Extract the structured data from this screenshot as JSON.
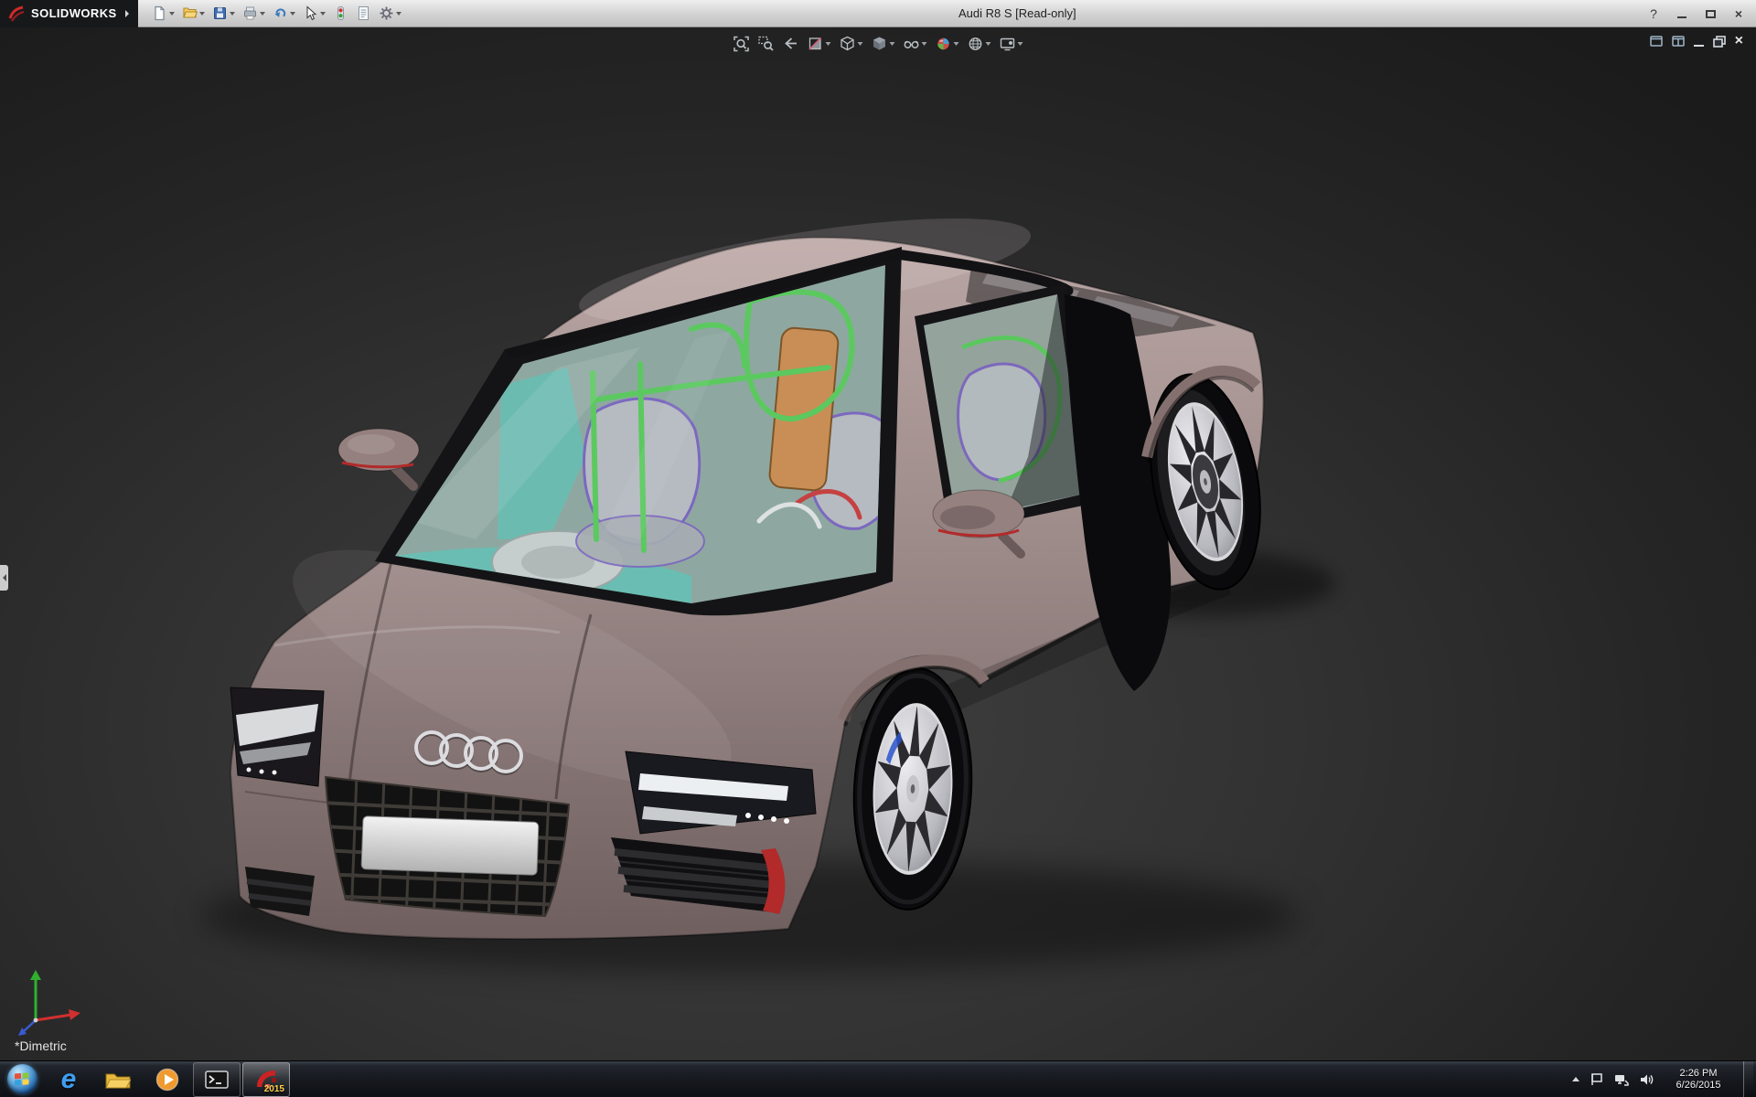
{
  "titlebar": {
    "logo_text": "SOLIDWORKS",
    "title": "Audi R8 S [Read-only]",
    "help_glyph": "?",
    "toolbar_icons": [
      "new-document-icon",
      "open-icon",
      "save-icon",
      "print-icon",
      "undo-icon",
      "select-cursor-icon",
      "rebuild-icon",
      "file-properties-icon",
      "options-icon"
    ]
  },
  "heads_up_toolbar": {
    "icons": [
      "zoom-to-fit-icon",
      "zoom-to-area-icon",
      "previous-view-icon",
      "section-view-icon",
      "view-orientation-icon",
      "display-style-icon",
      "hide-show-items-icon",
      "edit-appearance-icon",
      "apply-scene-icon",
      "view-settings-icon"
    ]
  },
  "document_controls": {
    "icons": [
      "window-pane-icon",
      "window-panes-icon",
      "minimize-icon",
      "restore-icon",
      "close-icon"
    ],
    "close_glyph": "×"
  },
  "viewport": {
    "view_label": "*Dimetric"
  },
  "taskbar": {
    "apps": [
      "start-button",
      "internet-explorer",
      "file-explorer",
      "media-player",
      "command-prompt",
      "solidworks"
    ],
    "ie_glyph": "e",
    "solidworks_badge": "2015",
    "clock": {
      "time": "2:26 PM",
      "date": "6/26/2015"
    }
  },
  "window_controls": {
    "close_glyph": "×"
  },
  "colors": {
    "car-body": "#9c8a89",
    "car-body-light": "#b9a6a4",
    "car-body-dark": "#6f5f5f",
    "rollcage-green": "#55cb55",
    "interior-orange": "#d08a4a",
    "dashboard-teal": "#5fc2b4",
    "seat-gray": "#b9bcc2",
    "seat-trim-purple": "#7a5fc0",
    "accent-red": "#b22a2a",
    "caliper-blue": "#2b55cc",
    "triad-x": "#d03030",
    "triad-y": "#2fb02f",
    "triad-z": "#3a5bd0"
  }
}
